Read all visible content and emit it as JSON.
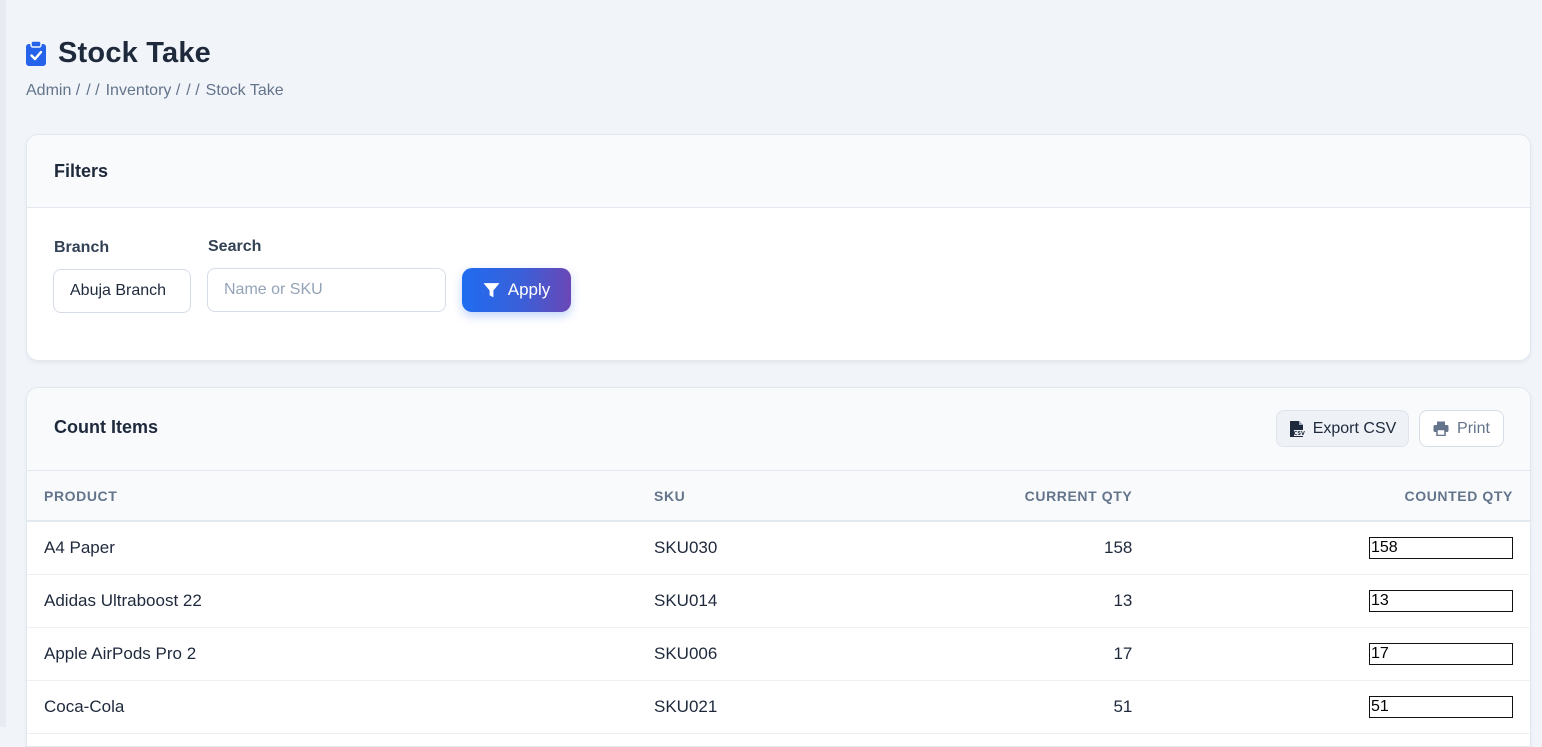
{
  "page": {
    "title": "Stock Take",
    "title_icon": "clipboard-check-icon",
    "breadcrumb": [
      "Admin /",
      "/ /",
      "Inventory /",
      "/ /",
      "Stock Take"
    ]
  },
  "filters": {
    "title": "Filters",
    "branch_label": "Branch",
    "branch_value": "Abuja Branch",
    "search_label": "Search",
    "search_placeholder": "Name or SKU",
    "search_value": "",
    "apply_label": "Apply",
    "apply_icon": "filter-icon"
  },
  "count_items": {
    "title": "Count Items",
    "export_label": "Export CSV",
    "export_icon": "csv-file-icon",
    "print_label": "Print",
    "print_icon": "printer-icon",
    "columns": [
      "PRODUCT",
      "SKU",
      "CURRENT QTY",
      "COUNTED QTY"
    ],
    "rows": [
      {
        "product": "A4 Paper",
        "sku": "SKU030",
        "current_qty": "158",
        "counted_qty": "158"
      },
      {
        "product": "Adidas Ultraboost 22",
        "sku": "SKU014",
        "current_qty": "13",
        "counted_qty": "13"
      },
      {
        "product": "Apple AirPods Pro 2",
        "sku": "SKU006",
        "current_qty": "17",
        "counted_qty": "17"
      },
      {
        "product": "Coca-Cola",
        "sku": "SKU021",
        "current_qty": "51",
        "counted_qty": "51"
      }
    ]
  },
  "colors": {
    "accent": "#2563eb",
    "accent_gradient_end": "#6a47b5",
    "background": "#f1f4f9",
    "text": "#1e293b",
    "muted": "#64748b"
  }
}
